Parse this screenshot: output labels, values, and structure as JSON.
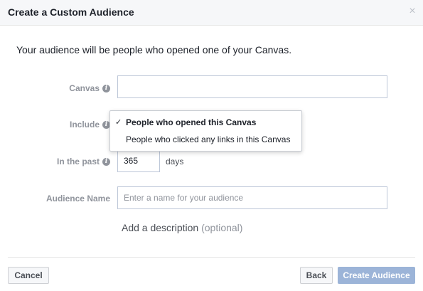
{
  "dialog": {
    "title": "Create a Custom Audience",
    "close_symbol": "×",
    "intro": "Your audience will be people who opened one of your Canvas."
  },
  "form": {
    "canvas": {
      "label": "Canvas",
      "value": ""
    },
    "include": {
      "label": "Include",
      "options": [
        {
          "label": "People who opened this Canvas",
          "selected": true
        },
        {
          "label": "People who clicked any links in this Canvas",
          "selected": false
        }
      ],
      "check_symbol": "✓"
    },
    "in_the_past": {
      "label": "In the past",
      "value": "365",
      "unit": "days"
    },
    "audience_name": {
      "label": "Audience Name",
      "placeholder": "Enter a name for your audience",
      "value": ""
    },
    "add_description": {
      "text": "Add a description",
      "optional_text": "(optional)"
    }
  },
  "footer": {
    "cancel_label": "Cancel",
    "back_label": "Back",
    "create_label": "Create Audience"
  },
  "icons": {
    "info": "info-icon",
    "close": "close-icon",
    "check": "check-icon"
  },
  "colors": {
    "primary_disabled": "#9cb4d8",
    "label_gray": "#90949c",
    "border": "#bdc7d8"
  }
}
